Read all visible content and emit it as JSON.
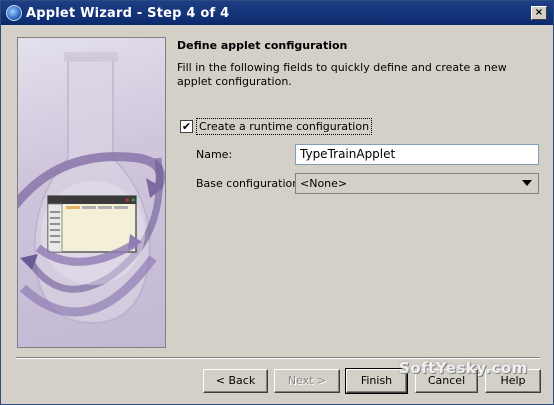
{
  "window": {
    "title": "Applet Wizard - Step 4 of 4",
    "close_label": "×"
  },
  "content": {
    "heading": "Define applet configuration",
    "description": "Fill in the following fields to quickly define and create a new applet configuration."
  },
  "form": {
    "runtime_checkbox": {
      "label": "Create a runtime configuration",
      "checked": true,
      "mark": "✔"
    },
    "name": {
      "label": "Name:",
      "value": "TypeTrainApplet"
    },
    "base_configuration": {
      "label": "Base configuration:",
      "selected": "<None>"
    }
  },
  "buttons": {
    "back": "< Back",
    "next": "Next >",
    "finish": "Finish",
    "cancel": "Cancel",
    "help": "Help"
  },
  "watermark": "SoftYesky.com",
  "colors": {
    "titlebar": "#0b2a6e",
    "window_bg": "#d4d0c8",
    "side_panel": "#c3b8d4",
    "arrow_purple": "#7d6aa3"
  },
  "icons": [
    "app-icon",
    "close-icon",
    "flask-illustration",
    "window-illustration",
    "dropdown-arrow-icon",
    "checkmark-icon"
  ]
}
